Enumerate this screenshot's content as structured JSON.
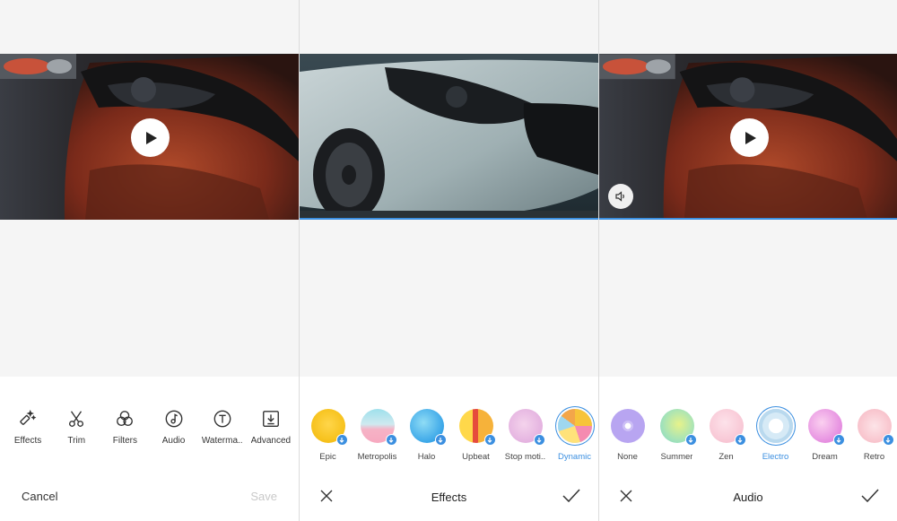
{
  "editor": {
    "tools": [
      {
        "label": "Effects",
        "icon": "effects-wand-icon"
      },
      {
        "label": "Trim",
        "icon": "scissors-icon"
      },
      {
        "label": "Filters",
        "icon": "filters-icon"
      },
      {
        "label": "Audio",
        "icon": "music-note-icon"
      },
      {
        "label": "Waterma..",
        "icon": "text-t-icon"
      },
      {
        "label": "Advanced",
        "icon": "download-box-icon"
      }
    ],
    "cancel_label": "Cancel",
    "save_label": "Save"
  },
  "effects": {
    "title": "Effects",
    "items": [
      {
        "label": "Epic",
        "downloadable": true,
        "selected": false
      },
      {
        "label": "Metropolis",
        "downloadable": true,
        "selected": false
      },
      {
        "label": "Halo",
        "downloadable": true,
        "selected": false
      },
      {
        "label": "Upbeat",
        "downloadable": true,
        "selected": false
      },
      {
        "label": "Stop moti..",
        "downloadable": true,
        "selected": false
      },
      {
        "label": "Dynamic",
        "downloadable": false,
        "selected": true
      }
    ]
  },
  "audio": {
    "title": "Audio",
    "items": [
      {
        "label": "None",
        "downloadable": false,
        "selected": false
      },
      {
        "label": "Summer",
        "downloadable": true,
        "selected": false
      },
      {
        "label": "Zen",
        "downloadable": true,
        "selected": false
      },
      {
        "label": "Electro",
        "downloadable": false,
        "selected": true
      },
      {
        "label": "Dream",
        "downloadable": true,
        "selected": false
      },
      {
        "label": "Retro",
        "downloadable": true,
        "selected": false
      }
    ]
  },
  "colors": {
    "accent": "#3b8fe0",
    "panel_bg": "#f5f5f5",
    "disabled_text": "#c9c9c9"
  }
}
